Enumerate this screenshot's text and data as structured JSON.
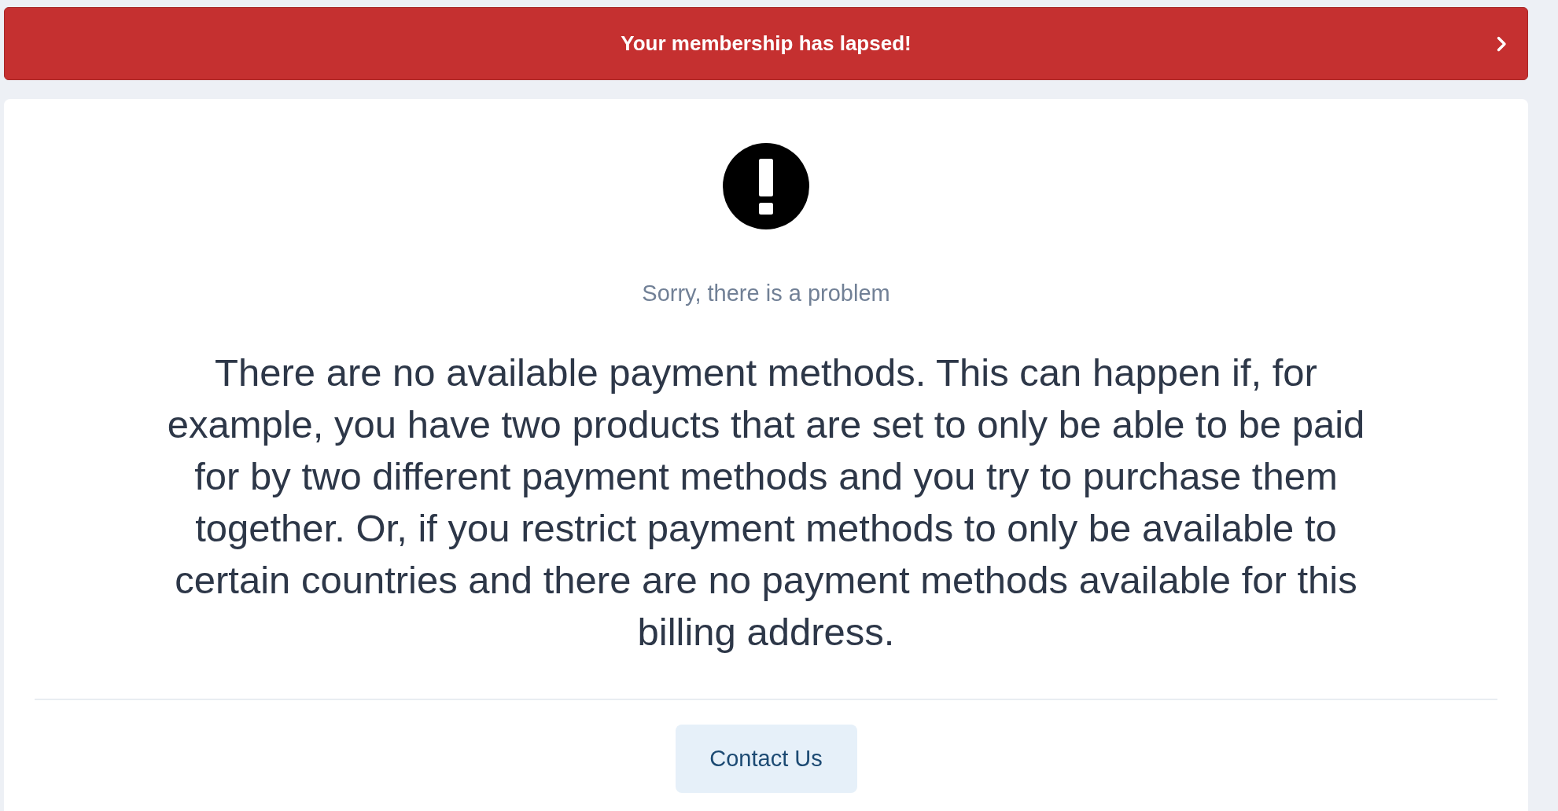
{
  "banner": {
    "message": "Your membership has lapsed!"
  },
  "error": {
    "heading": "Sorry, there is a problem",
    "message": "There are no available payment methods. This can happen if, for example, you have two products that are set to only be able to be paid for by two different payment methods and you try to purchase them together. Or, if you restrict payment methods to only be available to certain countries and there are no payment methods available for this billing address."
  },
  "buttons": [
    {
      "label": "Contact Us"
    }
  ]
}
